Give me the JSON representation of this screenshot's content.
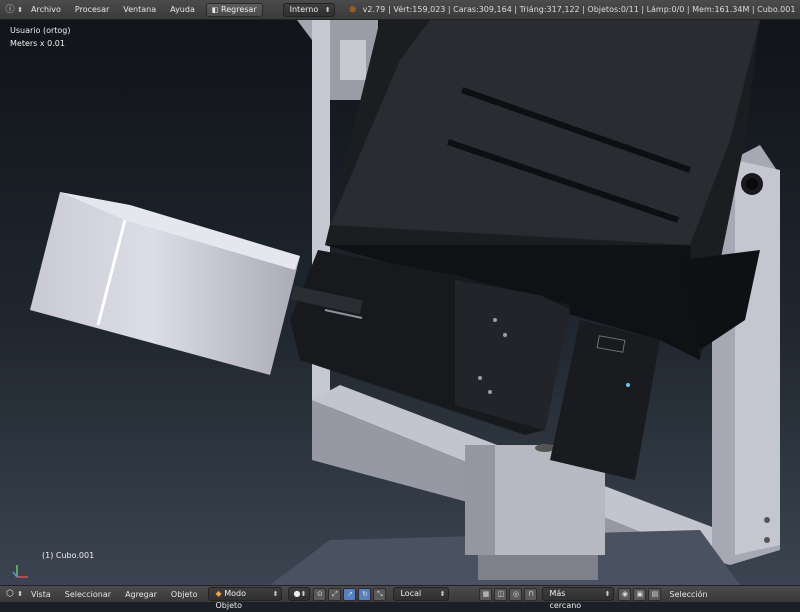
{
  "header": {
    "info_icon": "info-icon",
    "menus": [
      "Archivo",
      "Procesar",
      "Ventana",
      "Ayuda"
    ],
    "back_button": "Regresar",
    "render_engine": "Interno",
    "version": "v2.79",
    "stats": "Vért:159,023 | Caras:309,164 | Triáng:317,122 | Objetos:0/11 | Lámp:0/0 | Mem:161.34M | Cubo.001"
  },
  "viewport": {
    "view_name": "Usuario (ortog)",
    "units": "Meters x 0.01",
    "active_object": "(1) Cubo.001"
  },
  "footer": {
    "menus": [
      "Vista",
      "Seleccionar",
      "Agregar",
      "Objeto"
    ],
    "mode": "Modo Objeto",
    "orientation": "Local",
    "snap_target": "Más cercano",
    "selection_label": "Selección"
  },
  "colors": {
    "header_bg": "#3f3f3f",
    "accent": "#5680c2",
    "blender_logo": "#e87d0d"
  }
}
